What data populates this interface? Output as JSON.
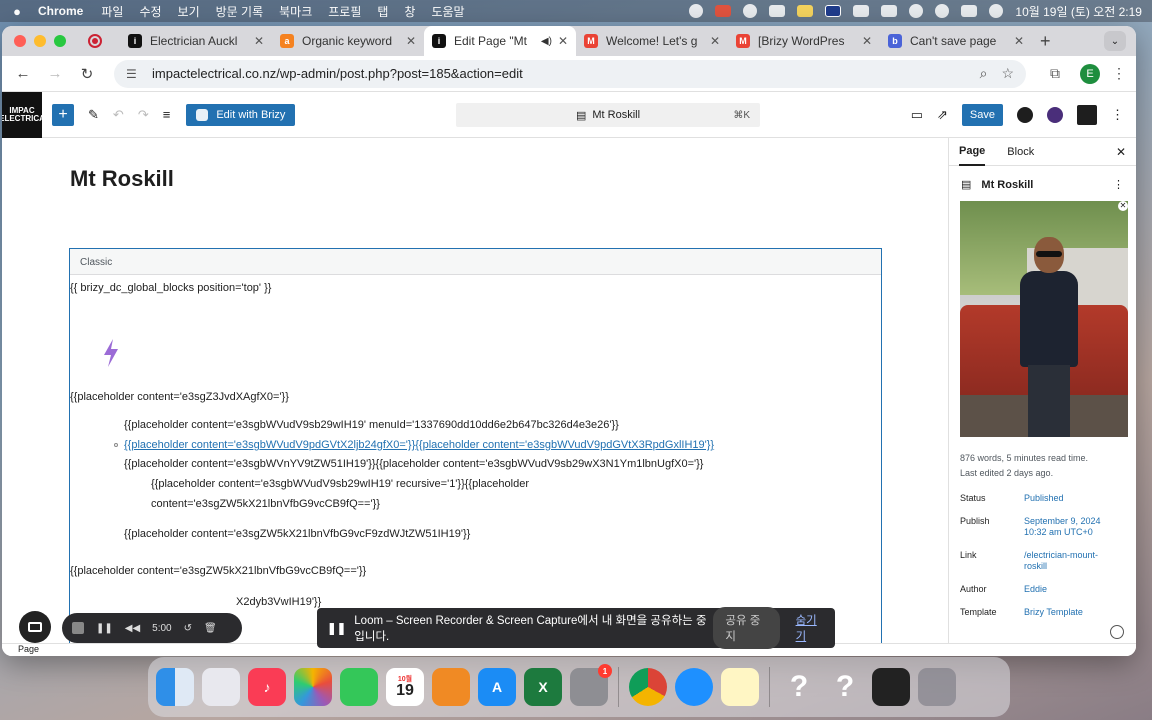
{
  "menubar": {
    "app": "Chrome",
    "items": [
      "파일",
      "수정",
      "보기",
      "방문 기록",
      "북마크",
      "프로필",
      "탭",
      "창",
      "도움말"
    ],
    "clock": "10월 19일 (토) 오전 2:19"
  },
  "tabs": [
    {
      "title": "Electrician Auckl",
      "favicon": "impac-logo"
    },
    {
      "title": "Organic keyword",
      "favicon": "ahrefs-icon"
    },
    {
      "title": "Edit Page \"Mt",
      "favicon": "impac-logo",
      "active": true
    },
    {
      "title": "Welcome! Let's g",
      "favicon": "gmail-icon"
    },
    {
      "title": "[Brizy WordPres",
      "favicon": "gmail-icon"
    },
    {
      "title": "Can't save page",
      "favicon": "brizy-icon"
    }
  ],
  "address": {
    "url": "impactelectrical.co.nz/wp-admin/post.php?post=185&action=edit",
    "profile_initial": "E"
  },
  "toolbar": {
    "brizy_label": "Edit with Brizy",
    "command_label": "Mt Roskill",
    "command_shortcut": "⌘K",
    "save_label": "Save"
  },
  "editor": {
    "page_title": "Mt Roskill",
    "classic_label": "Classic",
    "lines": [
      "{{ brizy_dc_global_blocks position='top' }}",
      "{{placeholder content='e3sgZ3JvdXAgfX0='}}",
      "{{placeholder content='e3sgbWVudV9sb29wIH19' menuId='1337690dd10dd6e2b647bc326d4e3e26'}}",
      "{{placeholder content='e3sgbWVudV9pdGVtX2ljb24gfX0='}}{{placeholder content='e3sgbWVudV9pdGVtX3RpdGxlIH19'}}",
      "{{placeholder content='e3sgbWVnYV9tZW51IH19'}}{{placeholder content='e3sgbWVudV9sb29wX3N1Ym1lbnUgfX0='}}",
      "{{placeholder content='e3sgbWVudV9sb29wIH19' recursive='1'}}{{placeholder",
      "content='e3sgZW5kX21lbnVfbG9vcCB9fQ=='}}",
      "{{placeholder content='e3sgZW5kX21lbnVfbG9vcF9zdWJtZW51IH19'}}",
      "{{placeholder content='e3sgZW5kX21lbnVfbG9vcCB9fQ=='}}",
      "X2dyb3VwIH19'}}"
    ]
  },
  "sidebar": {
    "tab_page": "Page",
    "tab_block": "Block",
    "page_name": "Mt Roskill",
    "words": "876 words, 5 minutes read time.",
    "edited": "Last edited 2 days ago.",
    "rows": [
      {
        "key": "Status",
        "value": "Published"
      },
      {
        "key": "Publish",
        "value": "September 9, 2024 10:32 am UTC+0"
      },
      {
        "key": "Link",
        "value": "/electrician-mount-roskill"
      },
      {
        "key": "Author",
        "value": "Eddie"
      },
      {
        "key": "Template",
        "value": "Brizy Template"
      }
    ]
  },
  "statusbar": {
    "label": "Page"
  },
  "loom": {
    "timer": "5:00",
    "share_text": "Loom – Screen Recorder & Screen Capture에서 내 화면을 공유하는 중입니다.",
    "stop_label": "공유 중지",
    "hide_label": "숨기기"
  },
  "dock": {
    "calendar_month": "10월",
    "calendar_day": "19",
    "settings_badge": "1"
  },
  "colors": {
    "wp_blue": "#2271b1",
    "menubar": "#2b2b35"
  }
}
